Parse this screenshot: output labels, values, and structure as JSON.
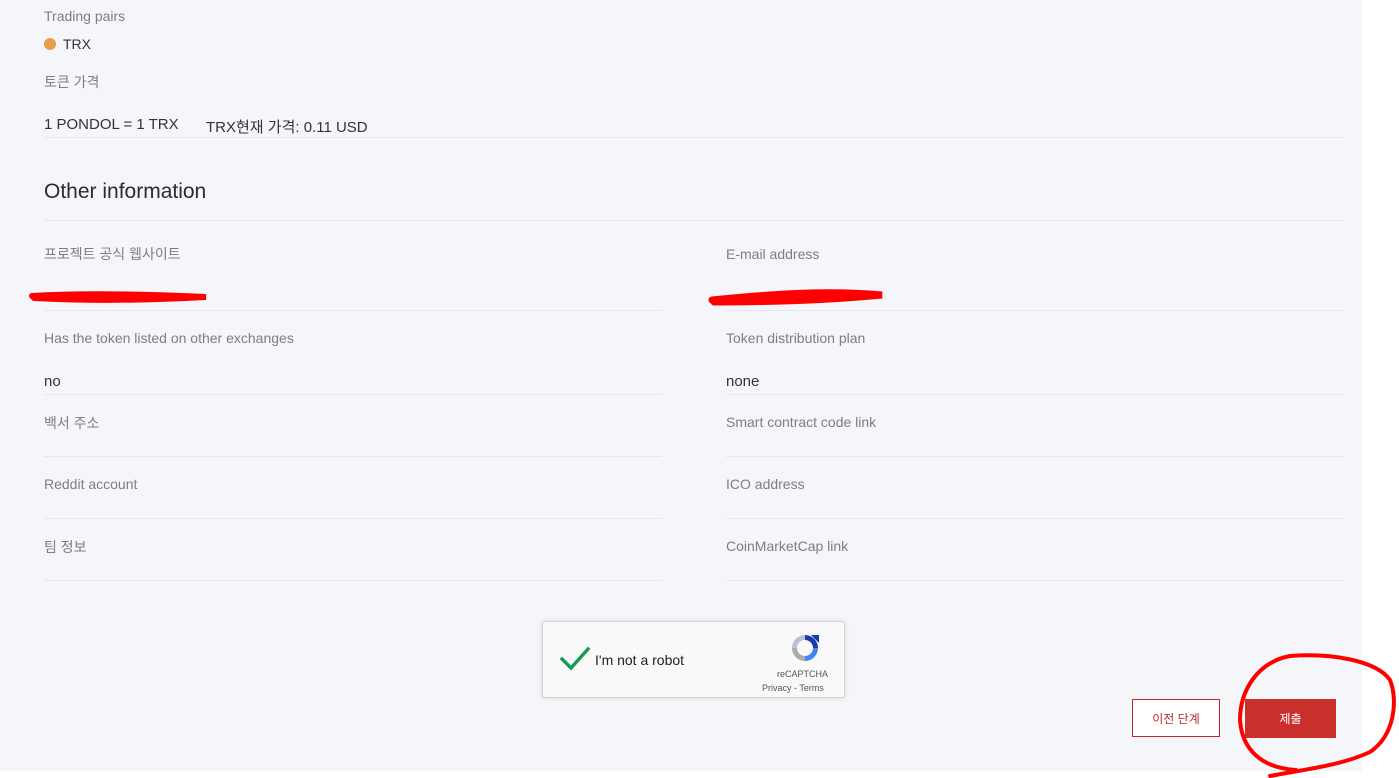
{
  "trading": {
    "label": "Trading pairs",
    "pair": "TRX",
    "pair_color": "#e4a04d"
  },
  "price": {
    "label": "토큰 가격",
    "ratio": "1 PONDOL = 1 TRX",
    "current": "TRX현재 가격: 0.11 USD"
  },
  "other": {
    "heading": "Other information",
    "left": [
      {
        "label": "프로젝트 공식 웹사이트",
        "value": ""
      },
      {
        "label": "Has the token listed on other exchanges",
        "value": "no"
      },
      {
        "label": "백서 주소",
        "value": ""
      },
      {
        "label": "Reddit account",
        "value": ""
      },
      {
        "label": "팀 정보",
        "value": ""
      }
    ],
    "right": [
      {
        "label": "E-mail address",
        "value": ""
      },
      {
        "label": "Token distribution plan",
        "value": "none"
      },
      {
        "label": "Smart contract code link",
        "value": ""
      },
      {
        "label": "ICO address",
        "value": ""
      },
      {
        "label": "CoinMarketCap link",
        "value": ""
      }
    ]
  },
  "captcha": {
    "label": "I'm not a robot",
    "brand": "reCAPTCHA",
    "privacy": "Privacy",
    "sep": " - ",
    "terms": "Terms",
    "check_color": "#0f9d58"
  },
  "actions": {
    "prev_label": "이전 단계",
    "submit_label": "제출",
    "accent": "#c9302c"
  },
  "annotations": {
    "redaction_color": "#ff0000"
  }
}
